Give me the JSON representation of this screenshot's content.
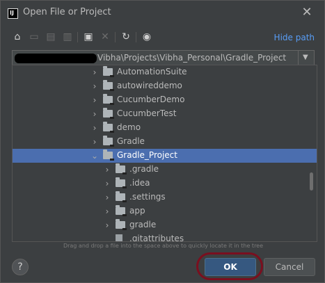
{
  "window": {
    "title": "Open File or Project"
  },
  "toolbar": {
    "icons": [
      "home-icon",
      "desktop-icon",
      "project-icon",
      "module-icon",
      "new-folder-icon",
      "delete-icon",
      "refresh-icon",
      "show-hidden-icon"
    ],
    "hide_path_label": "Hide path"
  },
  "path": {
    "value": "Vibha\\Projects\\Vibha_Personal\\Gradle_Project"
  },
  "tree": {
    "items": [
      {
        "label": "AutomationSuite",
        "type": "folder",
        "expandable": true,
        "expanded": false,
        "depth": 1,
        "selected": false
      },
      {
        "label": "autowireddemo",
        "type": "folder",
        "expandable": true,
        "expanded": false,
        "depth": 1,
        "selected": false
      },
      {
        "label": "CucumberDemo",
        "type": "folder",
        "expandable": true,
        "expanded": false,
        "depth": 1,
        "selected": false
      },
      {
        "label": "CucumberTest",
        "type": "folder",
        "expandable": true,
        "expanded": false,
        "depth": 1,
        "selected": false
      },
      {
        "label": "demo",
        "type": "folder",
        "expandable": true,
        "expanded": false,
        "depth": 1,
        "selected": false
      },
      {
        "label": "Gradle",
        "type": "folder",
        "expandable": true,
        "expanded": false,
        "depth": 1,
        "selected": false
      },
      {
        "label": "Gradle_Project",
        "type": "folder",
        "expandable": true,
        "expanded": true,
        "depth": 1,
        "selected": true
      },
      {
        "label": ".gradle",
        "type": "folder",
        "expandable": true,
        "expanded": false,
        "depth": 2,
        "selected": false
      },
      {
        "label": ".idea",
        "type": "folder",
        "expandable": true,
        "expanded": false,
        "depth": 2,
        "selected": false
      },
      {
        "label": ".settings",
        "type": "folder",
        "expandable": true,
        "expanded": false,
        "depth": 2,
        "selected": false
      },
      {
        "label": "app",
        "type": "folder",
        "expandable": true,
        "expanded": false,
        "depth": 2,
        "selected": false
      },
      {
        "label": "gradle",
        "type": "folder",
        "expandable": true,
        "expanded": false,
        "depth": 2,
        "selected": false
      },
      {
        "label": ".gitattributes",
        "type": "file",
        "expandable": false,
        "expanded": false,
        "depth": 2,
        "selected": false
      }
    ]
  },
  "hint": "Drag and drop a file into the space above to quickly locate it in the tree",
  "buttons": {
    "help": "?",
    "ok": "OK",
    "cancel": "Cancel"
  },
  "colors": {
    "background": "#3c3f41",
    "selection": "#4b6eaf",
    "link": "#589df6",
    "ok_button": "#365880",
    "highlight_ring": "#7a0f1f"
  }
}
